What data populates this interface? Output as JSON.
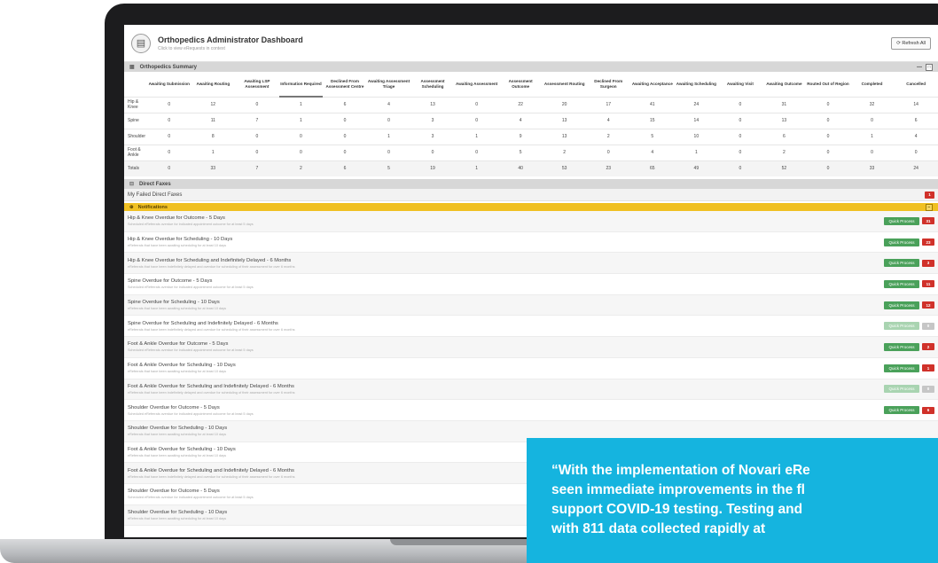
{
  "header": {
    "title": "Orthopedics Administrator Dashboard",
    "subtitle": "Click to view eRequests in context",
    "refresh_label": "Refresh All",
    "refresh_icon": "refresh-icon",
    "logo_icon": "dashboard-icon"
  },
  "summary": {
    "title": "Orthopedics Summary",
    "columns": [
      "Awaiting Submission",
      "Awaiting Routing",
      "Awaiting LSP Assessment",
      "Information Required",
      "Declined From Assessment Centre",
      "Awaiting Assessment Triage",
      "Assessment Scheduling",
      "Awaiting Assessment",
      "Assessment Outcome",
      "Assessment Routing",
      "Declined From Surgeon",
      "Awaiting Acceptance",
      "Awaiting Scheduling",
      "Awaiting Visit",
      "Awaiting Outcome",
      "Routed Out of Region",
      "Completed",
      "Cancelled"
    ],
    "rows": [
      {
        "label": "Hip & Knee",
        "values": [
          "0",
          "12",
          "0",
          "1",
          "6",
          "4",
          "13",
          "0",
          "22",
          "20",
          "17",
          "41",
          "24",
          "0",
          "31",
          "0",
          "32",
          "14"
        ]
      },
      {
        "label": "Spine",
        "values": [
          "0",
          "11",
          "7",
          "1",
          "0",
          "0",
          "3",
          "0",
          "4",
          "13",
          "4",
          "15",
          "14",
          "0",
          "13",
          "0",
          "0",
          "6"
        ]
      },
      {
        "label": "Shoulder",
        "values": [
          "0",
          "8",
          "0",
          "0",
          "0",
          "1",
          "3",
          "1",
          "9",
          "13",
          "2",
          "5",
          "10",
          "0",
          "6",
          "0",
          "1",
          "4"
        ]
      },
      {
        "label": "Foot & Ankle",
        "values": [
          "0",
          "1",
          "0",
          "0",
          "0",
          "0",
          "0",
          "0",
          "5",
          "2",
          "0",
          "4",
          "1",
          "0",
          "2",
          "0",
          "0",
          "0"
        ]
      }
    ],
    "totals": {
      "label": "Totals",
      "values": [
        "0",
        "33",
        "7",
        "2",
        "6",
        "5",
        "19",
        "1",
        "40",
        "53",
        "23",
        "65",
        "49",
        "0",
        "52",
        "0",
        "33",
        "24"
      ]
    }
  },
  "direct": {
    "title": "Direct Faxes",
    "row_label": "My Failed Direct Faxes",
    "count": "1"
  },
  "notifications": {
    "title": "Notifications",
    "button_label": "Quick Process",
    "items": [
      {
        "title": "Hip & Knee Overdue for Outcome - 5 Days",
        "desc": "Scheduled eReferrals overdue for indicated appointment outcome for at least 5 days",
        "count": "31",
        "enabled": true
      },
      {
        "title": "Hip & Knee Overdue for Scheduling - 10 Days",
        "desc": "eReferrals that have been awaiting scheduling for at least 10 days",
        "count": "23",
        "enabled": true
      },
      {
        "title": "Hip & Knee Overdue for Scheduling and Indefinitely Delayed - 6 Months",
        "desc": "eReferrals that have been indefinitely delayed and overdue for scheduling of their assessment for over 6 months",
        "count": "3",
        "enabled": true
      },
      {
        "title": "Spine Overdue for Outcome - 5 Days",
        "desc": "Scheduled eReferrals overdue for indicated appointment outcome for at least 5 days",
        "count": "11",
        "enabled": true
      },
      {
        "title": "Spine Overdue for Scheduling - 10 Days",
        "desc": "eReferrals that have been awaiting scheduling for at least 10 days",
        "count": "12",
        "enabled": true
      },
      {
        "title": "Spine Overdue for Scheduling and Indefinitely Delayed - 6 Months",
        "desc": "eReferrals that have been indefinitely delayed and overdue for scheduling of their assessment for over 6 months",
        "count": "0",
        "enabled": false
      },
      {
        "title": "Foot & Ankle Overdue for Outcome - 5 Days",
        "desc": "Scheduled eReferrals overdue for indicated appointment outcome for at least 5 days",
        "count": "2",
        "enabled": true
      },
      {
        "title": "Foot & Ankle Overdue for Scheduling - 10 Days",
        "desc": "eReferrals that have been awaiting scheduling for at least 10 days",
        "count": "1",
        "enabled": true
      },
      {
        "title": "Foot & Ankle Overdue for Scheduling and Indefinitely Delayed - 6 Months",
        "desc": "eReferrals that have been indefinitely delayed and overdue for scheduling of their assessment for over 6 months",
        "count": "0",
        "enabled": false
      },
      {
        "title": "Shoulder Overdue for Outcome - 5 Days",
        "desc": "Scheduled eReferrals overdue for indicated appointment outcome for at least 5 days",
        "count": "6",
        "enabled": true
      },
      {
        "title": "Shoulder Overdue for Scheduling - 10 Days",
        "desc": "eReferrals that have been awaiting scheduling for at least 10 days",
        "count": "",
        "enabled": true
      },
      {
        "title": "Foot & Ankle Overdue for Scheduling - 10 Days",
        "desc": "eReferrals that have been awaiting scheduling for at least 10 days",
        "count": "",
        "enabled": true
      },
      {
        "title": "Foot & Ankle Overdue for Scheduling and Indefinitely Delayed - 6 Months",
        "desc": "eReferrals that have been indefinitely delayed and overdue for scheduling of their assessment for over 6 months",
        "count": "",
        "enabled": true
      },
      {
        "title": "Shoulder Overdue for Outcome - 5 Days",
        "desc": "Scheduled eReferrals overdue for indicated appointment outcome for at least 5 days",
        "count": "",
        "enabled": true
      },
      {
        "title": "Shoulder Overdue for Scheduling - 10 Days",
        "desc": "eReferrals that have been awaiting scheduling for at least 10 days",
        "count": "",
        "enabled": true
      }
    ]
  },
  "quote": {
    "lines": [
      "“With the implementation of Novari eRe",
      " seen immediate improvements in the fl",
      "support COVID-19 testing. Testing and",
      "with 811 data collected rapidly at"
    ]
  },
  "colors": {
    "accent_yellow": "#f0c022",
    "quick_process_green": "#4aa15a",
    "count_red": "#d0312a",
    "quote_blue": "#15b4df"
  }
}
